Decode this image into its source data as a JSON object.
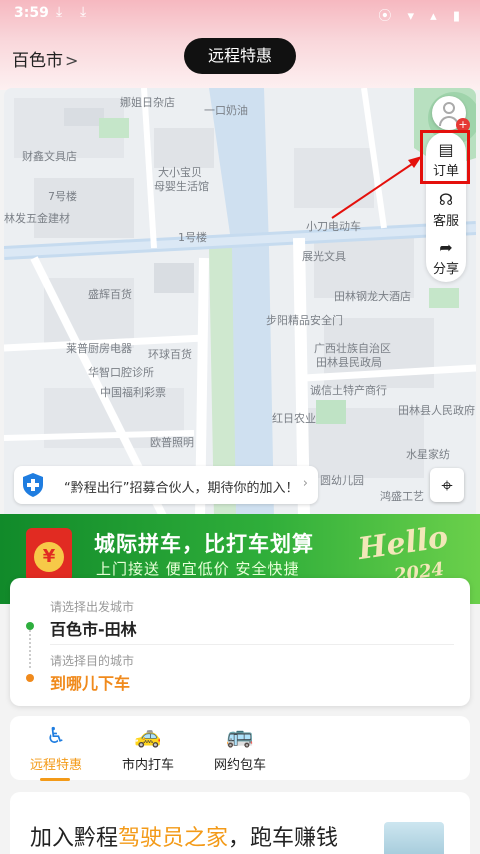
{
  "status_bar": {
    "time": "3:59",
    "download_icons": [
      "download-icon",
      "download-icon"
    ],
    "status_icons": "⦿ ▾ ▴ ▮"
  },
  "header": {
    "city": "百色市",
    "city_chevron": ">",
    "title": "远程特惠"
  },
  "map": {
    "labels": [
      "娜姐日杂店",
      "一口奶油",
      "财鑫文具店",
      "大小宝贝",
      "母婴生活馆",
      "7号楼",
      "林发五金建材",
      "1号楼",
      "小刀电动车",
      "展光文具",
      "盛辉百货",
      "田林钢龙大酒店",
      "步阳精品安全门",
      "莱普厨房电器",
      "环球百货",
      "广西壮族自治区",
      "田林县民政局",
      "华智口腔诊所",
      "中国福利彩票",
      "诚信土特产商行",
      "红日农业",
      "田林县人民政府",
      "欧普照明",
      "水星家纺",
      "圆幼儿园",
      "鸿盛工艺"
    ]
  },
  "tools": {
    "order": {
      "label": "订单",
      "icon": "order-icon"
    },
    "service": {
      "label": "客服",
      "icon": "headset-icon"
    },
    "share": {
      "label": "分享",
      "icon": "share-icon"
    },
    "avatar_badge": "+"
  },
  "recruit": {
    "text": "“黔程出行”招募合伙人，期待你的加入！",
    "arrow": "›"
  },
  "banner": {
    "headline": "城际拼车，比打车划算",
    "sub": "上门接送  便宜低价  安全快捷",
    "hello": "Hello",
    "year": "2024",
    "coin": "¥"
  },
  "route": {
    "from_hint": "请选择出发城市",
    "from_value": "百色市-田林",
    "to_hint": "请选择目的城市",
    "to_value": "到哪儿下车",
    "from_color": "#2eae3e",
    "to_color": "#f08a1c"
  },
  "services": [
    {
      "label": "远程特惠",
      "icon": "seat-icon",
      "active": true
    },
    {
      "label": "市内打车",
      "icon": "taxi-icon",
      "active": false
    },
    {
      "label": "网约包车",
      "icon": "bus-icon",
      "active": false
    }
  ],
  "promo": {
    "prefix": "加入黔程",
    "highlight": "驾驶员之家",
    "suffix": "，跑车赚钱"
  },
  "colors": {
    "accent": "#f39a18",
    "highlight_box": "#e4100c",
    "banner_green": "#2fae3a"
  }
}
